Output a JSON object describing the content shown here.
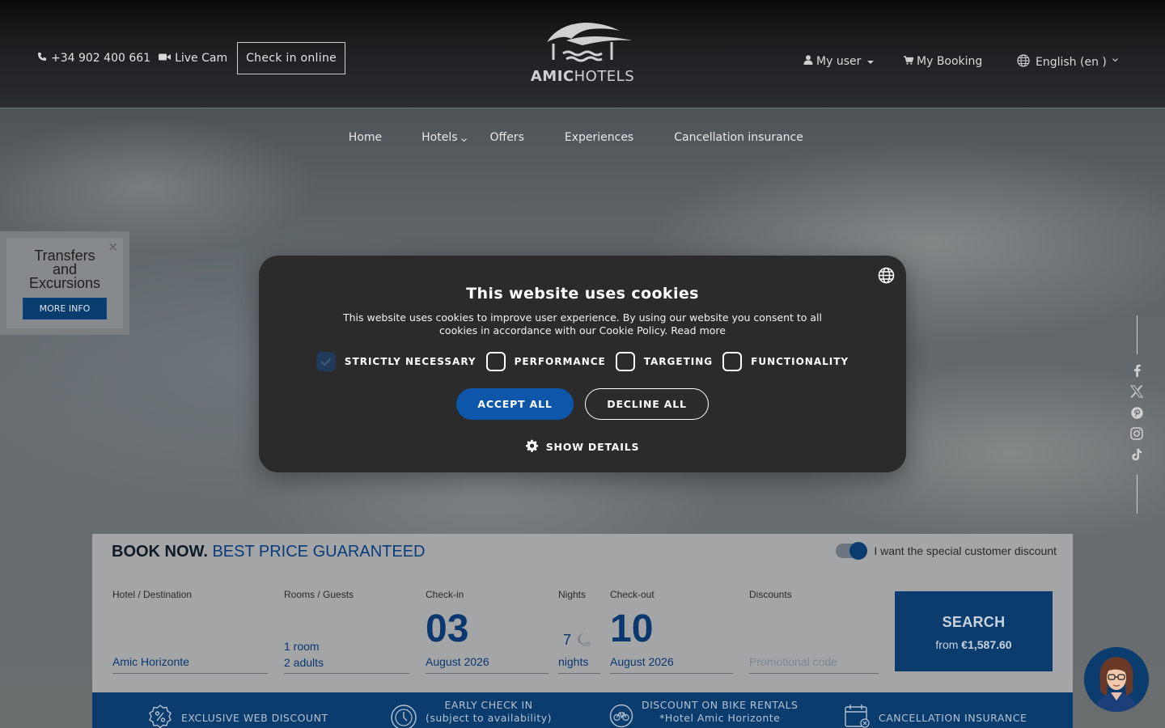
{
  "topbar": {
    "phone": "+34 902 400 661",
    "live_cam": "Live Cam",
    "check_in": "Check in online",
    "logo_text_bold": "AMIC",
    "logo_text_light": "HOTELS",
    "my_user": "My user",
    "my_booking": "My Booking",
    "language": "English (en )"
  },
  "nav": {
    "items": [
      "Home",
      "Hotels",
      "Offers",
      "Experiences",
      "Cancellation insurance"
    ]
  },
  "side_promo": {
    "title_line1": "Transfers",
    "title_line2": "and",
    "title_line3": "Excursions",
    "button": "MORE INFO",
    "close": "×"
  },
  "cookie": {
    "title": "This website uses cookies",
    "body_line1": "This website uses cookies to improve user experience. By using our website you consent to all",
    "body_line2": "cookies in accordance with our Cookie Policy. Read more",
    "categories": [
      "STRICTLY NECESSARY",
      "PERFORMANCE",
      "TARGETING",
      "FUNCTIONALITY"
    ],
    "accept": "ACCEPT ALL",
    "decline": "DECLINE ALL",
    "show_details": "SHOW DETAILS"
  },
  "booking": {
    "title_bold": "BOOK NOW.",
    "title_blue": "BEST PRICE GUARANTEED",
    "discount_label": "I want the special customer discount",
    "hotel_label": "Hotel / Destination",
    "hotel_value": "Amic Horizonte",
    "rooms_label": "Rooms / Guests",
    "rooms_value": "1 room",
    "guests_value": "2 adults",
    "checkin_label": "Check-in",
    "checkin_day": "03",
    "checkin_month": "August 2026",
    "nights_label": "Nights",
    "nights_value": "7",
    "nights_unit": "nights",
    "checkout_label": "Check-out",
    "checkout_day": "10",
    "checkout_month": "August 2026",
    "discounts_label": "Discounts",
    "promo_placeholder": "Promotional code",
    "search": "SEARCH",
    "price_prefix": "from ",
    "price": "€1,587.60"
  },
  "perks": [
    {
      "icon": "percent-badge-icon",
      "line1": "EXCLUSIVE WEB DISCOUNT",
      "line2": ""
    },
    {
      "icon": "clock-icon",
      "line1": "EARLY CHECK IN",
      "line2": "(subject to availability)"
    },
    {
      "icon": "bike-icon",
      "line1": "DISCOUNT ON BIKE RENTALS",
      "line2": "*Hotel Amic Horizonte"
    },
    {
      "icon": "calendar-cancel-icon",
      "line1": "CANCELLATION INSURANCE",
      "line2": ""
    }
  ],
  "colors": {
    "brand_blue": "#0b3c6e",
    "accept_blue": "#0d56aa",
    "modal_bg": "#2b2b2b"
  }
}
